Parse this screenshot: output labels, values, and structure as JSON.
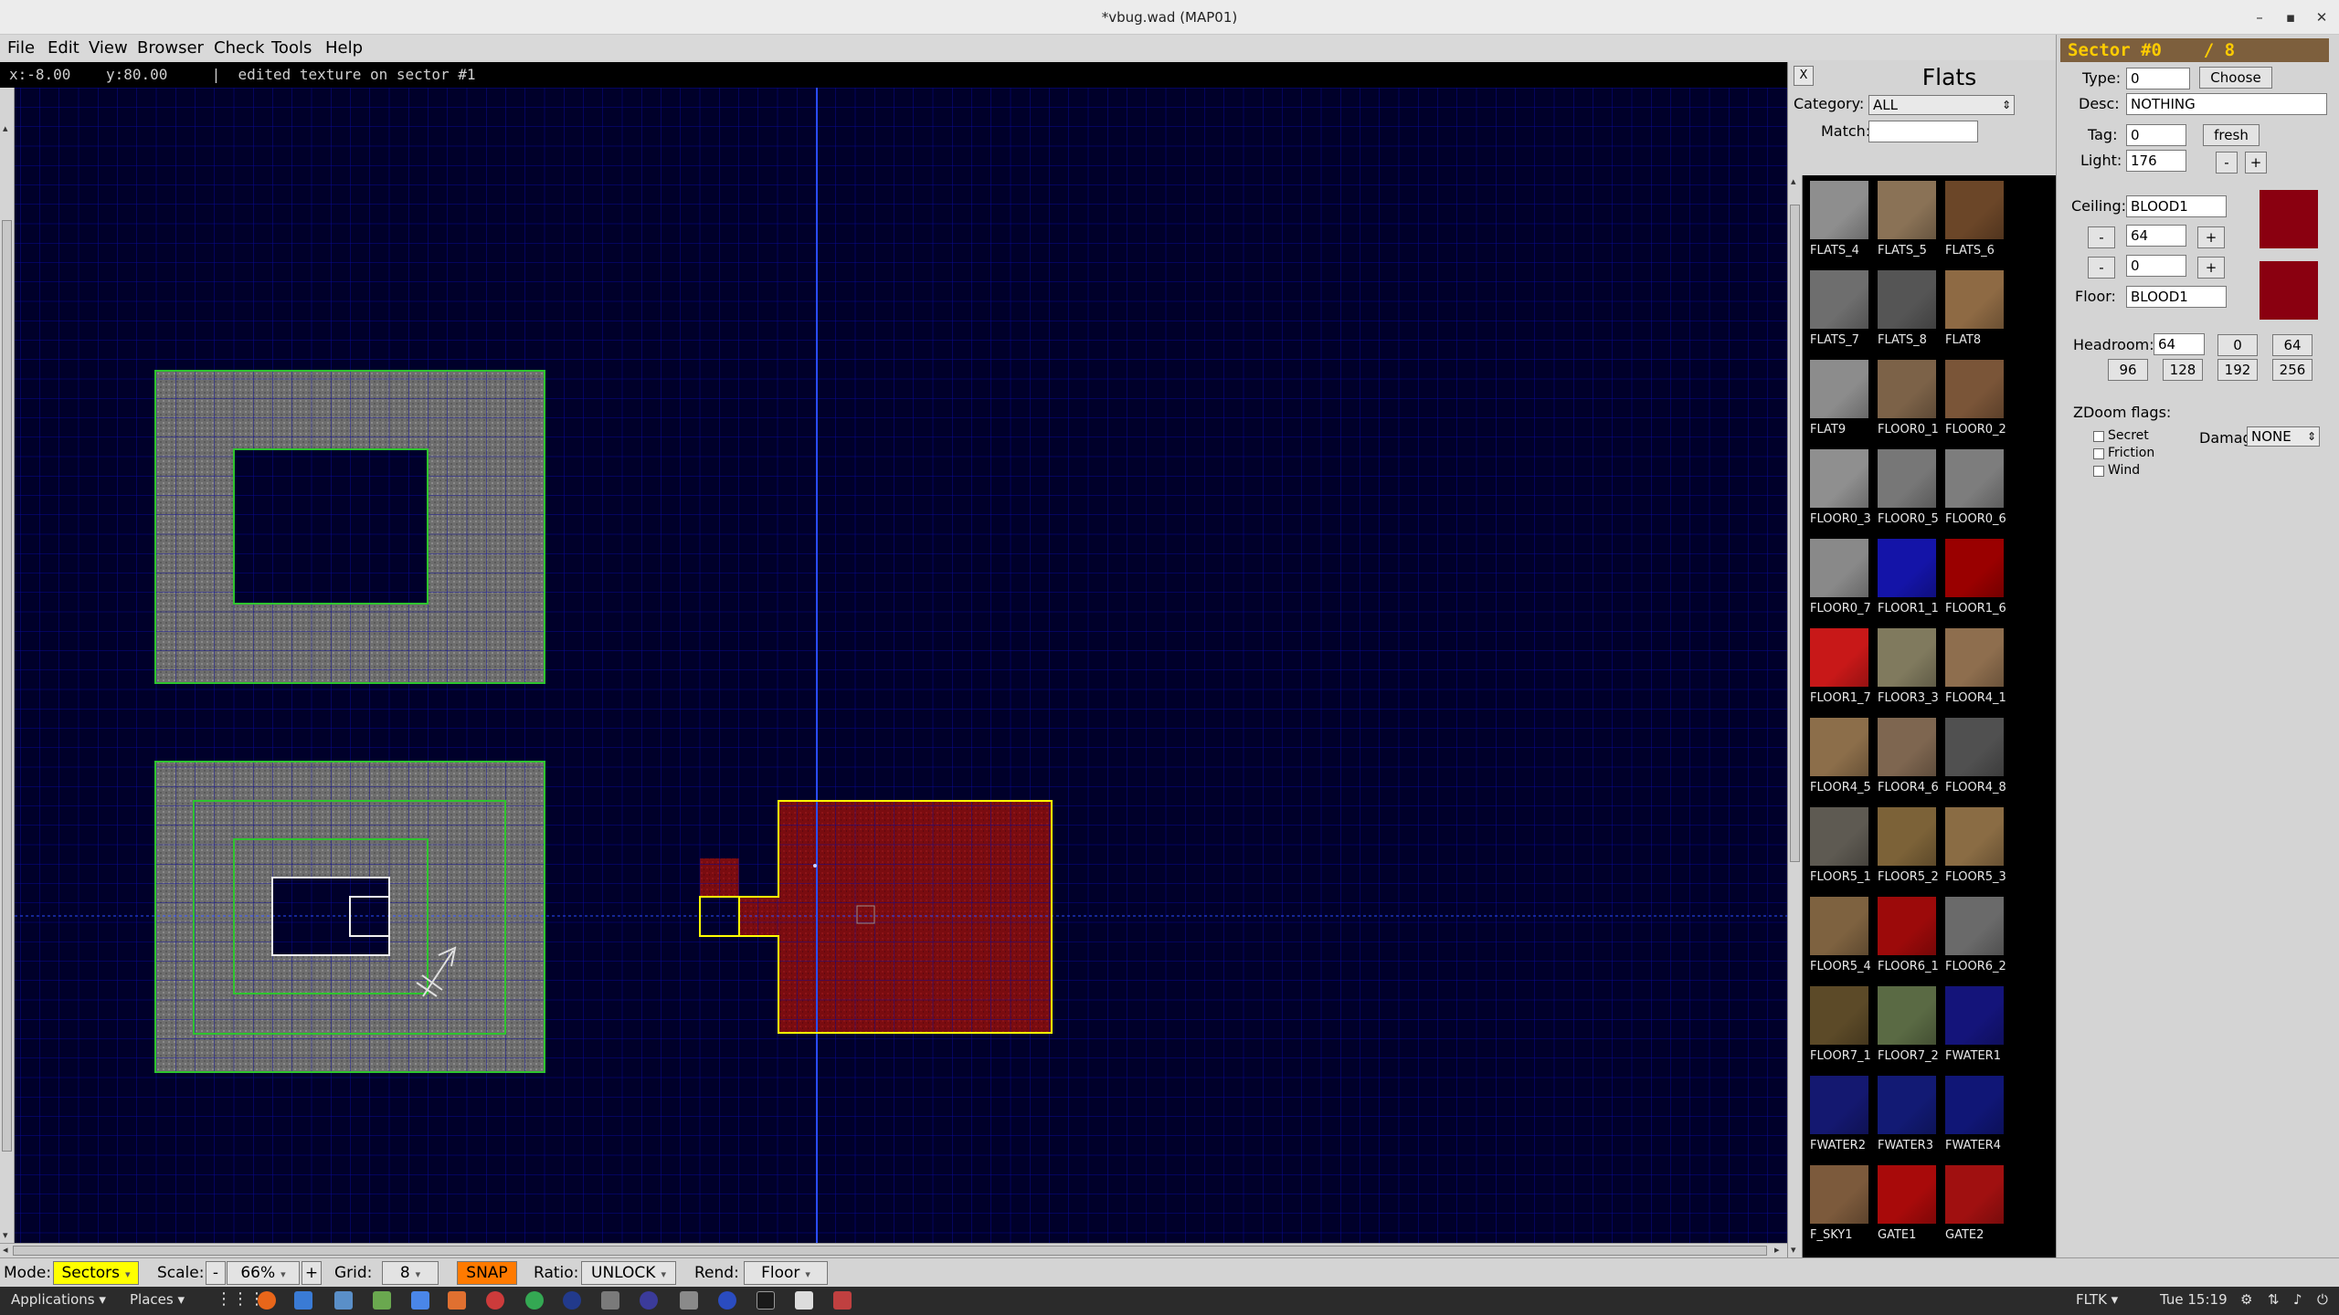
{
  "window": {
    "title": "*vbug.wad (MAP01)",
    "minimize_glyph": "–",
    "maximize_glyph": "▪",
    "close_glyph": "✕"
  },
  "menu": [
    "File",
    "Edit",
    "View",
    "Browser",
    "Check",
    "Tools",
    "Help"
  ],
  "status": {
    "coords": "x:-8.00    y:80.00",
    "separator": "|",
    "message": "edited texture on sector #1"
  },
  "browser": {
    "close_label": "X",
    "title": "Flats",
    "category_label": "Category:",
    "category_value": "ALL",
    "match_label": "Match:",
    "match_value": "",
    "tiles": [
      {
        "name": "FLATS_4",
        "color": "#8e8e8e"
      },
      {
        "name": "FLATS_5",
        "color": "#8a7256"
      },
      {
        "name": "FLATS_6",
        "color": "#6b4628"
      },
      {
        "name": "FLATS_7",
        "color": "#6e6e6e"
      },
      {
        "name": "FLATS_8",
        "color": "#555555"
      },
      {
        "name": "FLAT8",
        "color": "#8e6a44"
      },
      {
        "name": "FLAT9",
        "color": "#8c8c8c"
      },
      {
        "name": "FLOOR0_1",
        "color": "#7c6248"
      },
      {
        "name": "FLOOR0_2",
        "color": "#7a5538"
      },
      {
        "name": "FLOOR0_3",
        "color": "#8f8f8f"
      },
      {
        "name": "FLOOR0_5",
        "color": "#777777"
      },
      {
        "name": "FLOOR0_6",
        "color": "#7d7d7d"
      },
      {
        "name": "FLOOR0_7",
        "color": "#898989"
      },
      {
        "name": "FLOOR1_1",
        "color": "#1414a8"
      },
      {
        "name": "FLOOR1_6",
        "color": "#9a0000"
      },
      {
        "name": "FLOOR1_7",
        "color": "#c81818"
      },
      {
        "name": "FLOOR3_3",
        "color": "#807a5e"
      },
      {
        "name": "FLOOR4_1",
        "color": "#8e6e4e"
      },
      {
        "name": "FLOOR4_5",
        "color": "#8c6e4a"
      },
      {
        "name": "FLOOR4_6",
        "color": "#7e6650"
      },
      {
        "name": "FLOOR4_8",
        "color": "#505050"
      },
      {
        "name": "FLOOR5_1",
        "color": "#5e5a52"
      },
      {
        "name": "FLOOR5_2",
        "color": "#7c6238"
      },
      {
        "name": "FLOOR5_3",
        "color": "#8a6c44"
      },
      {
        "name": "FLOOR5_4",
        "color": "#7e6240"
      },
      {
        "name": "FLOOR6_1",
        "color": "#9c0a0a"
      },
      {
        "name": "FLOOR6_2",
        "color": "#6a6a6a"
      },
      {
        "name": "FLOOR7_1",
        "color": "#5c4a28"
      },
      {
        "name": "FLOOR7_2",
        "color": "#5a6a44"
      },
      {
        "name": "FWATER1",
        "color": "#14147a"
      },
      {
        "name": "FWATER2",
        "color": "#141870"
      },
      {
        "name": "FWATER3",
        "color": "#121a74"
      },
      {
        "name": "FWATER4",
        "color": "#101676"
      },
      {
        "name": "F_SKY1",
        "color": "#7c5a3c"
      },
      {
        "name": "GATE1",
        "color": "#a80a0a"
      },
      {
        "name": "GATE2",
        "color": "#a01010"
      }
    ]
  },
  "sector": {
    "header": "Sector #0    / 8",
    "type_label": "Type:",
    "type_value": "0",
    "choose_label": "Choose",
    "desc_label": "Desc:",
    "desc_value": "NOTHING",
    "tag_label": "Tag:",
    "tag_value": "0",
    "fresh_label": "fresh",
    "light_label": "Light:",
    "light_value": "176",
    "minus": "-",
    "plus": "+",
    "ceiling_label": "Ceiling:",
    "ceiling_tex": "BLOOD1",
    "ceiling_height": "64",
    "floor_height": "0",
    "floor_label": "Floor:",
    "floor_tex": "BLOOD1",
    "ceiling_color": "#8a0010",
    "floor_color": "#8a0010",
    "headroom_label": "Headroom:",
    "headroom_value": "64",
    "headroom_presets": [
      "0",
      "64",
      "96",
      "128",
      "192",
      "256"
    ],
    "zdoom_label": "ZDoom flags:",
    "flags": [
      "Secret",
      "Friction",
      "Wind"
    ],
    "damage_label": "Damage:",
    "damage_value": "NONE"
  },
  "bottom": {
    "mode_label": "Mode:",
    "mode_value": "Sectors",
    "scale_label": "Scale:",
    "scale_minus": "-",
    "scale_value": "66%",
    "scale_plus": "+",
    "grid_label": "Grid:",
    "grid_value": "8",
    "snap_label": "SNAP",
    "ratio_label": "Ratio:",
    "ratio_value": "UNLOCK",
    "rend_label": "Rend:",
    "rend_value": "Floor",
    "mode_color": "#ffff00",
    "snap_color": "#ff7a00"
  },
  "taskbar": {
    "applications": "Applications ▾",
    "places": "Places ▾",
    "fltk": "FLTK ▾",
    "clock": "Tue 15:19"
  }
}
